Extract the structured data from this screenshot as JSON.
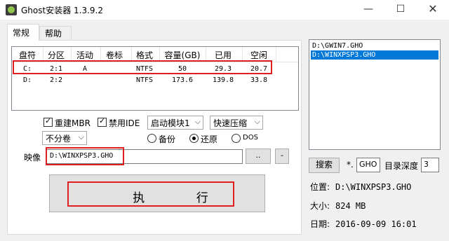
{
  "window": {
    "title": "Ghost安装器 1.3.9.2",
    "minimize_glyph": "—",
    "maximize_glyph": "☐",
    "close_glyph": "✕"
  },
  "tabs": [
    {
      "label": "常规",
      "active": true
    },
    {
      "label": "帮助",
      "active": false
    }
  ],
  "partition_table": {
    "columns": [
      "盘符",
      "分区",
      "活动",
      "卷标",
      "格式",
      "容量(GB)",
      "已用",
      "空闲"
    ],
    "rows": [
      {
        "drive": "C:",
        "partition": "2:1",
        "active": "A",
        "label": "",
        "format": "NTFS",
        "capacity": "50",
        "used": "29.3",
        "free": "20.7"
      },
      {
        "drive": "D:",
        "partition": "2:2",
        "active": "",
        "label": "",
        "format": "NTFS",
        "capacity": "173.6",
        "used": "139.8",
        "free": "33.8"
      }
    ]
  },
  "options": {
    "rebuild_mbr_label": "重建MBR",
    "rebuild_mbr_checked": true,
    "disable_ide_label": "禁用IDE",
    "disable_ide_checked": true,
    "boot_module": "启动模块1",
    "compression": "快速压缩",
    "split": "不分卷",
    "radio_backup": "备份",
    "radio_restore": "还原",
    "radio_dos": "DOS",
    "selected_mode": "restore"
  },
  "image": {
    "label": "映像",
    "path": "D:\\WINXPSP3.GHO",
    "browse_label": "..",
    "minus_label": "-"
  },
  "execute_label": "执 行",
  "file_list": {
    "items": [
      {
        "path": "D:\\GWIN7.GHO",
        "selected": false
      },
      {
        "path": "D:\\WINXPSP3.GHO",
        "selected": true
      }
    ]
  },
  "search": {
    "button_label": "搜索",
    "ext_prefix": "*.",
    "ext_value": "GHO",
    "depth_label": "目录深度",
    "depth_value": "3"
  },
  "details": {
    "location_label": "位置:",
    "location_value": "D:\\WINXPSP3.GHO",
    "size_label": "大小:",
    "size_value": "824 MB",
    "date_label": "日期:",
    "date_value": "2016-09-09  16:01"
  },
  "colors": {
    "highlight": "#e02020",
    "selection": "#0078d7"
  }
}
